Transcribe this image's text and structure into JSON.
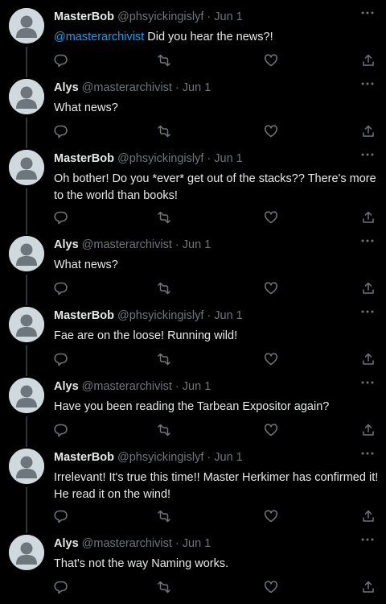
{
  "colors": {
    "background": "#000000",
    "text": "#e7e9ea",
    "secondary": "#71767b",
    "link": "#1d9bf0",
    "thread_line": "#333639"
  },
  "icons": {
    "reply": "reply-icon",
    "retweet": "retweet-icon",
    "like": "like-icon",
    "share": "share-icon",
    "more": "more-options-icon",
    "avatar": "default-avatar"
  },
  "tweets": [
    {
      "name": "MasterBob",
      "handle": "@phsyickingislyf",
      "sep": "·",
      "date": "Jun 1",
      "mention": "@masterarchivist",
      "text": " Did you hear the news?!"
    },
    {
      "name": "Alys",
      "handle": "@masterarchivist",
      "sep": "·",
      "date": "Jun 1",
      "mention": "",
      "text": "What news?"
    },
    {
      "name": "MasterBob",
      "handle": "@phsyickingislyf",
      "sep": "·",
      "date": "Jun 1",
      "mention": "",
      "text": "Oh bother! Do you *ever* get out of the stacks?? There's more to the world than books!"
    },
    {
      "name": "Alys",
      "handle": "@masterarchivist",
      "sep": "·",
      "date": "Jun 1",
      "mention": "",
      "text": "What news?"
    },
    {
      "name": "MasterBob",
      "handle": "@phsyickingislyf",
      "sep": "·",
      "date": "Jun 1",
      "mention": "",
      "text": "Fae are on the loose! Running wild!"
    },
    {
      "name": "Alys",
      "handle": "@masterarchivist",
      "sep": "·",
      "date": "Jun 1",
      "mention": "",
      "text": "Have you been reading the Tarbean Expositor again?"
    },
    {
      "name": "MasterBob",
      "handle": "@phsyickingislyf",
      "sep": "·",
      "date": "Jun 1",
      "mention": "",
      "text": "Irrelevant! It's true this time!! Master Herkimer has confirmed it! He read it on the wind!"
    },
    {
      "name": "Alys",
      "handle": "@masterarchivist",
      "sep": "·",
      "date": "Jun 1",
      "mention": "",
      "text": "That's not the way Naming works."
    }
  ]
}
